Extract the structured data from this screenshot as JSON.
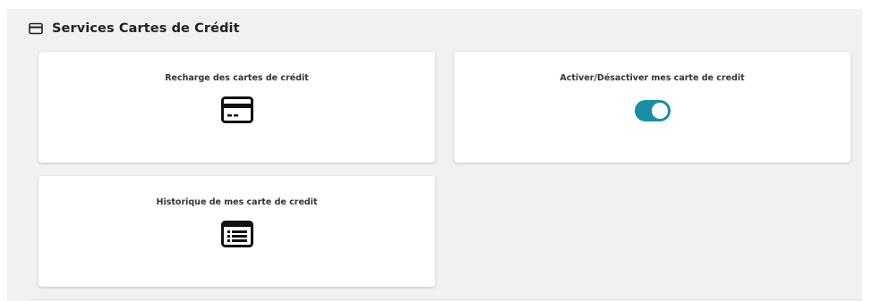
{
  "section": {
    "title": "Services Cartes de Crédit",
    "icon": "credit-card-icon"
  },
  "cards": [
    {
      "title": "Recharge des cartes de crédit",
      "icon": "credit-card-icon"
    },
    {
      "title": "Activer/Désactiver mes carte de credit",
      "control": "toggle",
      "toggle_on": true
    },
    {
      "title": "Historique de mes carte de credit",
      "icon": "list-icon"
    }
  ],
  "colors": {
    "toggle_on": "#1a8ea5",
    "panel_bg": "#f1f1f1",
    "card_bg": "#ffffff",
    "text": "#333333"
  }
}
